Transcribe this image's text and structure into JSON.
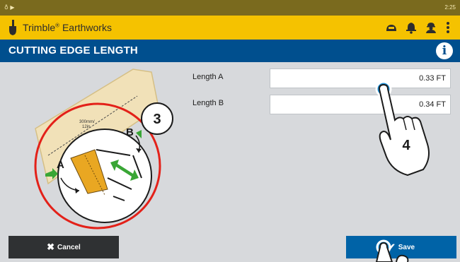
{
  "status_bar": {
    "left_text": "♁ ▶",
    "clock": "2:25"
  },
  "app": {
    "name": "Trimble",
    "name_mark": "®",
    "name_suffix": " Earthworks",
    "icons": [
      "machine-icon",
      "bell-icon",
      "operator-icon",
      "more-vertical-icon"
    ]
  },
  "page": {
    "title": "CUTTING EDGE LENGTH",
    "info_icon": "info-icon"
  },
  "fields": [
    {
      "label": "Length A",
      "value": "0.33 FT"
    },
    {
      "label": "Length B",
      "value": "0.34 FT"
    }
  ],
  "diagram": {
    "step_number": "3",
    "dimension_text_1": "300mm/",
    "dimension_text_2": "12in",
    "marker_a": "A",
    "marker_b": "B"
  },
  "touch_hint": {
    "step_number": "4"
  },
  "buttons": {
    "cancel": {
      "label": "Cancel",
      "icon": "close-icon"
    },
    "save": {
      "label": "Save",
      "icon": "check-icon"
    }
  },
  "colors": {
    "status_bar": "#7a6a1e",
    "app_bar": "#f5c200",
    "header": "#004f8e",
    "save_button": "#0063a7",
    "cancel_button": "#2f3133",
    "highlight_ring": "#e32119",
    "touch_point": "#1a8fd8"
  }
}
